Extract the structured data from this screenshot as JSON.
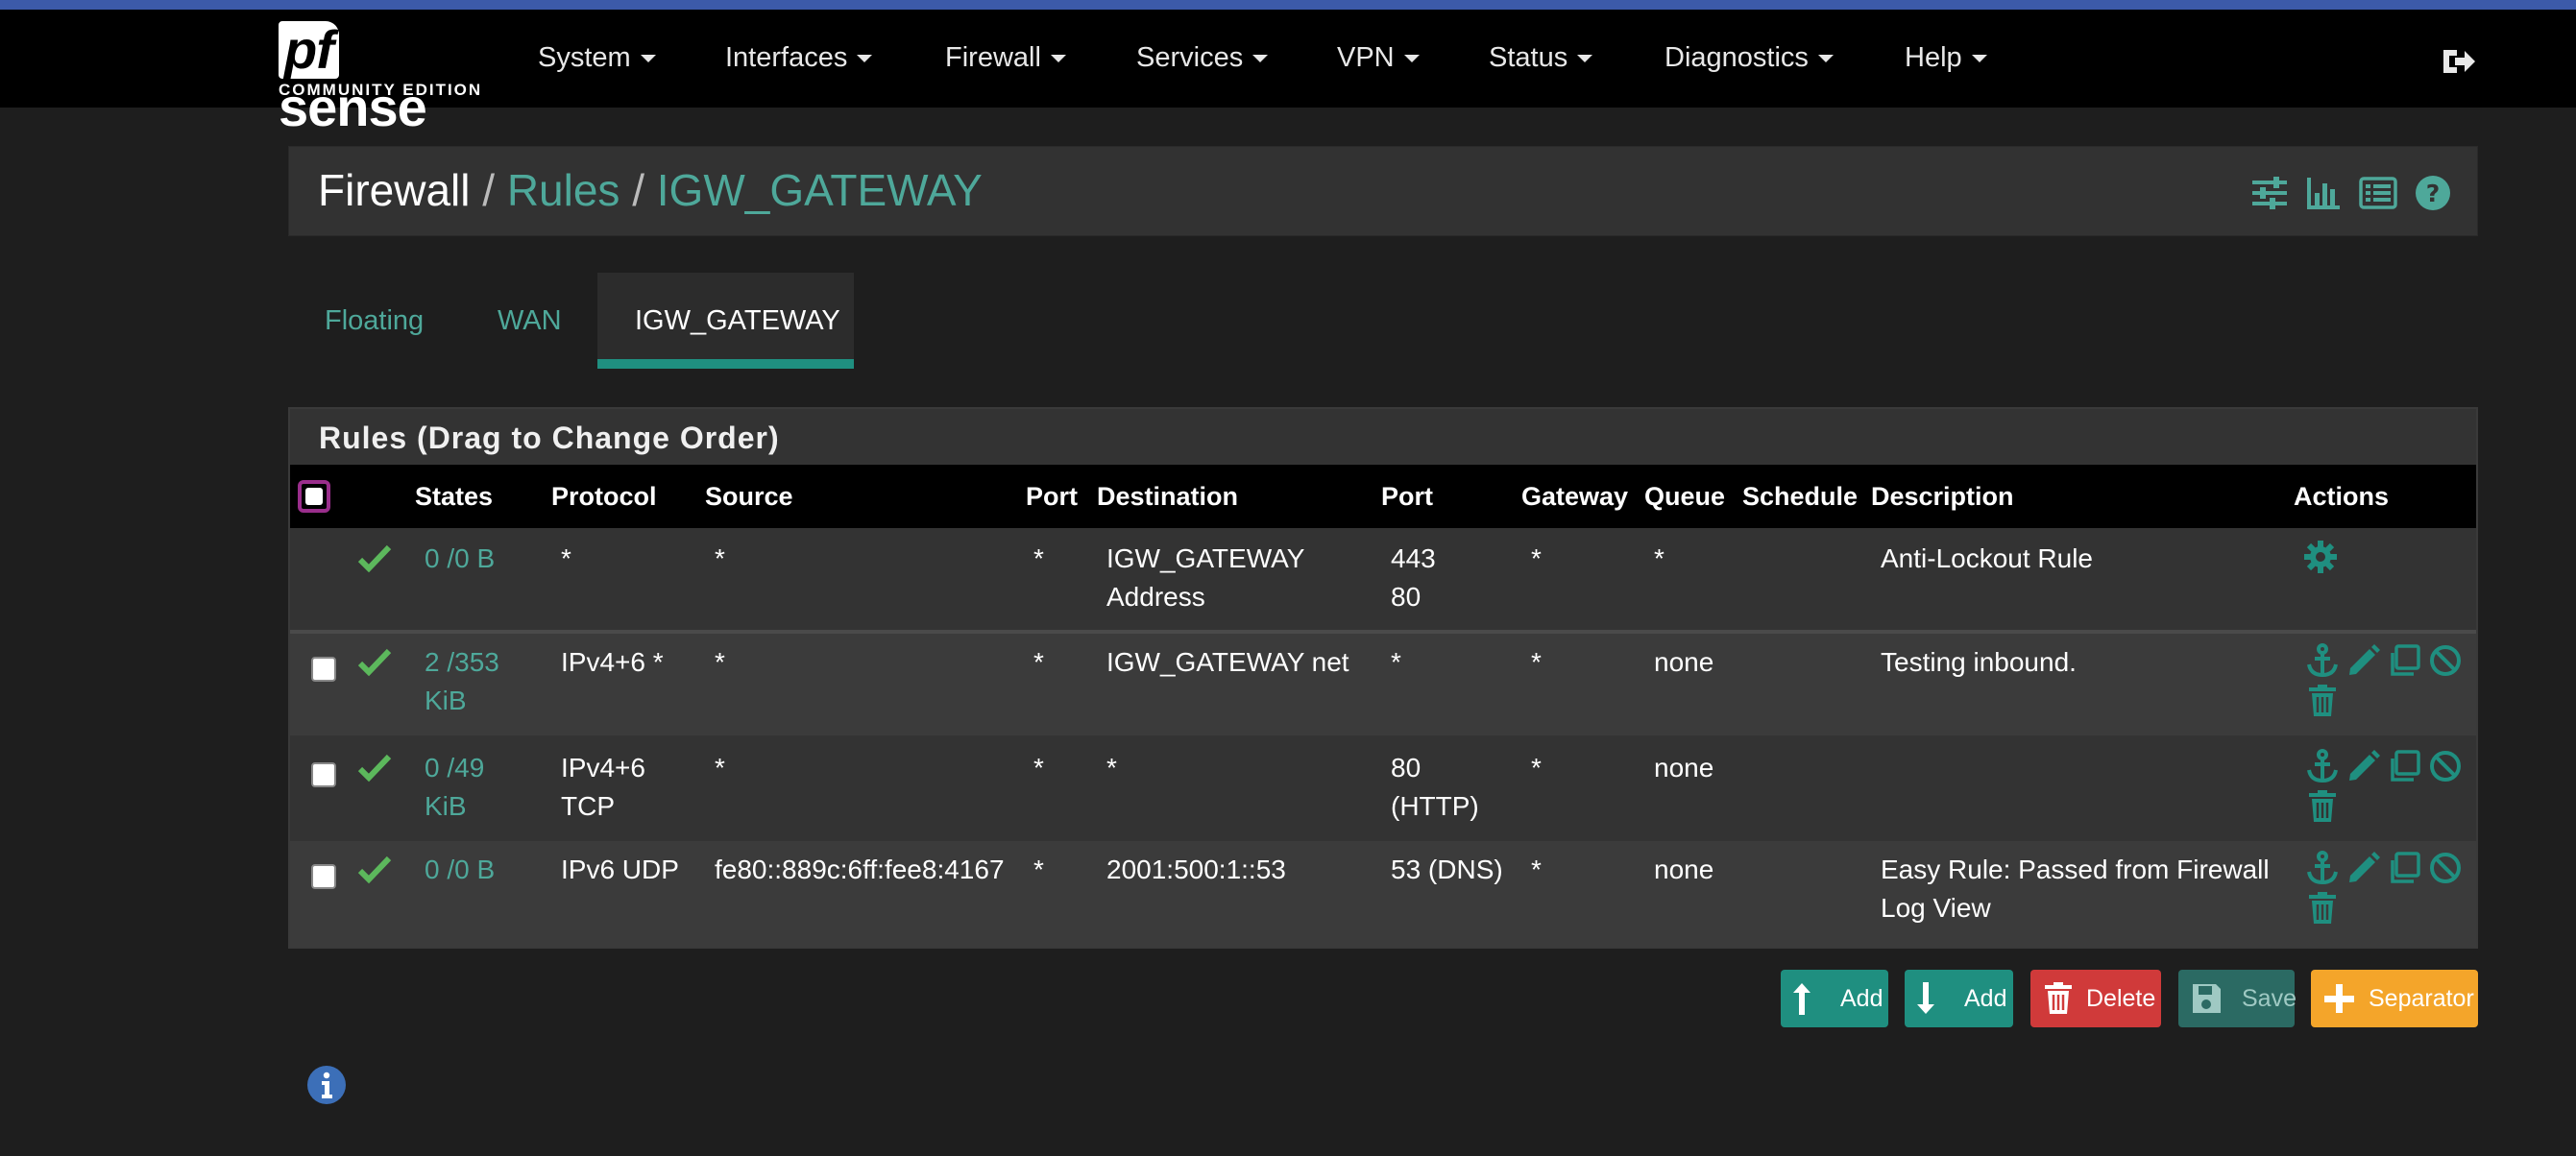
{
  "brand": {
    "logo_main": "sense",
    "logo_pf": "pf",
    "logo_sub": "COMMUNITY EDITION"
  },
  "nav": {
    "items": [
      {
        "label": "System"
      },
      {
        "label": "Interfaces"
      },
      {
        "label": "Firewall"
      },
      {
        "label": "Services"
      },
      {
        "label": "VPN"
      },
      {
        "label": "Status"
      },
      {
        "label": "Diagnostics"
      },
      {
        "label": "Help"
      }
    ],
    "logout_icon": "sign-out-icon"
  },
  "breadcrumb": {
    "root": "Firewall",
    "sep": "/",
    "rules": "Rules",
    "current": "IGW_GATEWAY"
  },
  "header_icons": [
    "sliders-icon",
    "bar-chart-icon",
    "list-icon",
    "help-icon"
  ],
  "tabs": [
    {
      "label": "Floating",
      "active": false
    },
    {
      "label": "WAN",
      "active": false
    },
    {
      "label": "IGW_GATEWAY",
      "active": true
    }
  ],
  "panel": {
    "title": "Rules (Drag to Change Order)"
  },
  "columns": {
    "states": "States",
    "protocol": "Protocol",
    "source": "Source",
    "src_port": "Port",
    "destination": "Destination",
    "dst_port": "Port",
    "gateway": "Gateway",
    "queue": "Queue",
    "schedule": "Schedule",
    "description": "Description",
    "actions": "Actions"
  },
  "rows": [
    {
      "states_1": "0 /0 B",
      "states_2": "",
      "protocol_1": "*",
      "protocol_2": "",
      "source": "*",
      "src_port": "*",
      "dest_1": "IGW_GATEWAY",
      "dest_2": "Address",
      "dport_1": "443",
      "dport_2": "80",
      "gateway": "*",
      "queue": "*",
      "schedule": "",
      "desc_1": "Anti-Lockout Rule",
      "desc_2": ""
    },
    {
      "states_1": "2 /353",
      "states_2": "KiB",
      "protocol_1": "IPv4+6 *",
      "protocol_2": "",
      "source": "*",
      "src_port": "*",
      "dest_1": "IGW_GATEWAY net",
      "dest_2": "",
      "dport_1": "*",
      "dport_2": "",
      "gateway": "*",
      "queue": "none",
      "schedule": "",
      "desc_1": "Testing inbound.",
      "desc_2": ""
    },
    {
      "states_1": "0 /49",
      "states_2": "KiB",
      "protocol_1": "IPv4+6",
      "protocol_2": "TCP",
      "source": "*",
      "src_port": "*",
      "dest_1": "*",
      "dest_2": "",
      "dport_1": "80",
      "dport_2": "(HTTP)",
      "gateway": "*",
      "queue": "none",
      "schedule": "",
      "desc_1": "",
      "desc_2": ""
    },
    {
      "states_1": "0 /0 B",
      "states_2": "",
      "protocol_1": "IPv6 UDP",
      "protocol_2": "",
      "source": "fe80::889c:6ff:fee8:4167",
      "src_port": "*",
      "dest_1": "2001:500:1::53",
      "dest_2": "",
      "dport_1": "53 (DNS)",
      "dport_2": "",
      "gateway": "*",
      "queue": "none",
      "schedule": "",
      "desc_1": "Easy Rule: Passed from Firewall",
      "desc_2": "Log View"
    }
  ],
  "buttons": {
    "add_top": "Add",
    "add_bottom": "Add",
    "delete": "Delete",
    "save": "Save",
    "separator": "Separator"
  },
  "colors": {
    "accent": "#1f8f80",
    "link": "#4ea89a",
    "pass": "#5cb85c",
    "danger": "#d03a3a",
    "warning": "#f4a52a",
    "topline": "#3c5aa9"
  }
}
